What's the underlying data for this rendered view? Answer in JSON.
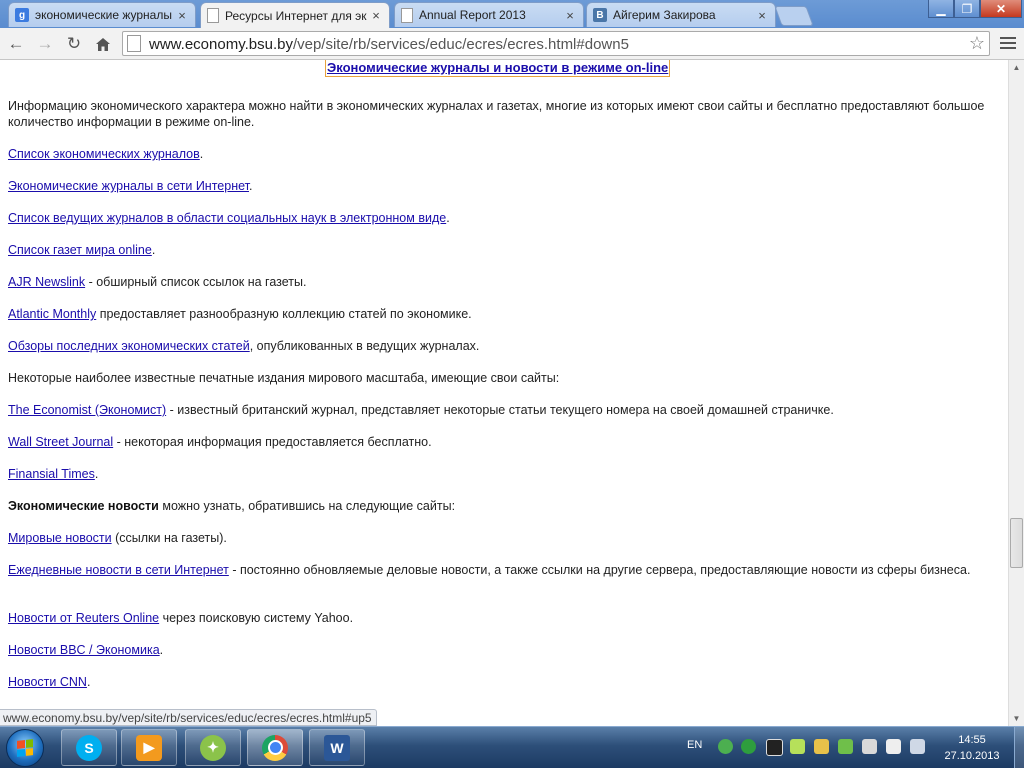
{
  "browser": {
    "tabs": [
      {
        "title": "экономические журналы",
        "favicon": "google-g-icon",
        "active": false
      },
      {
        "title": "Ресурсы Интернет для эк",
        "favicon": "page-icon",
        "active": true
      },
      {
        "title": "Annual Report 2013",
        "favicon": "page-icon",
        "active": false
      },
      {
        "title": "Айгерим Закирова",
        "favicon": "vk-icon",
        "active": false
      }
    ],
    "url_host": "www.economy.bsu.by",
    "url_path": "/vep/site/rb/services/educ/ecres/ecres.html#down5",
    "status_url": "www.economy.bsu.by/vep/site/rb/services/educ/ecres/ecres.html#up5"
  },
  "page": {
    "heading": "Экономические журналы и новости в режиме on-line",
    "intro": "Информацию экономического характера можно найти в экономических журналах и газетах, многие из которых имеют свои сайты и бесплатно предоставляют большое количество информации в режиме on-line.",
    "items": [
      {
        "link": "Список экономических журналов",
        "text": "."
      },
      {
        "link": "Экономические журналы в сети Интернет",
        "text": "."
      },
      {
        "link": "Список ведущих журналов в области социальных наук в электронном виде",
        "text": "."
      },
      {
        "link": "Список газет мира online",
        "text": "."
      },
      {
        "link": "AJR Newslink",
        "text": " - обширный список ссылок на газеты."
      },
      {
        "link": "Atlantic Monthly",
        "text": " предоставляет разнообразную коллекцию статей по экономике."
      },
      {
        "link": "Обзоры последних экономических статей",
        "text": ", опубликованных в ведущих журналах."
      }
    ],
    "print_intro": "Некоторые наиболее известные печатные издания мирового масштаба, имеющие свои сайты:",
    "print_items": [
      {
        "link": "The Economist (Экономист)",
        "text": " - известный британский журнал, представляет некоторые статьи текущего номера на своей домашней страничке."
      },
      {
        "link": "Wall Street Journal",
        "text": " - некоторая информация предоставляется бесплатно."
      },
      {
        "link": "Finansial Times",
        "text": "."
      }
    ],
    "news_intro_bold": "Экономические новости",
    "news_intro_text": " можно узнать, обратившись на следующие сайты:",
    "news_items": [
      {
        "link": "Мировые новости",
        "text": " (ссылки на газеты)."
      },
      {
        "link": "Ежедневные новости в сети Интернет",
        "text": " -  постоянно обновляемые деловые новости, а также ссылки на другие сервера, предоставляющие новости из сферы бизнеса."
      },
      {
        "link": "Новости от Reuters Online",
        "text": " через поисковую систему Yahoo."
      },
      {
        "link": "Новости BBC / Экономика",
        "text": "."
      },
      {
        "link": "Новости CNN",
        "text": "."
      }
    ]
  },
  "taskbar": {
    "apps": [
      {
        "name": "skype-icon",
        "color": "#00aff0"
      },
      {
        "name": "media-player-icon",
        "color": "#f39a1e"
      },
      {
        "name": "app-orbit-icon",
        "color": "#8bc34a"
      },
      {
        "name": "chrome-icon",
        "color": "#dd4b39"
      },
      {
        "name": "word-icon",
        "color": "#2b5797"
      }
    ],
    "lang": "EN",
    "time": "14:55",
    "date": "27.10.2013"
  },
  "colors": {
    "link": "#1a0dab",
    "titlebar": "#5a8ccf"
  }
}
